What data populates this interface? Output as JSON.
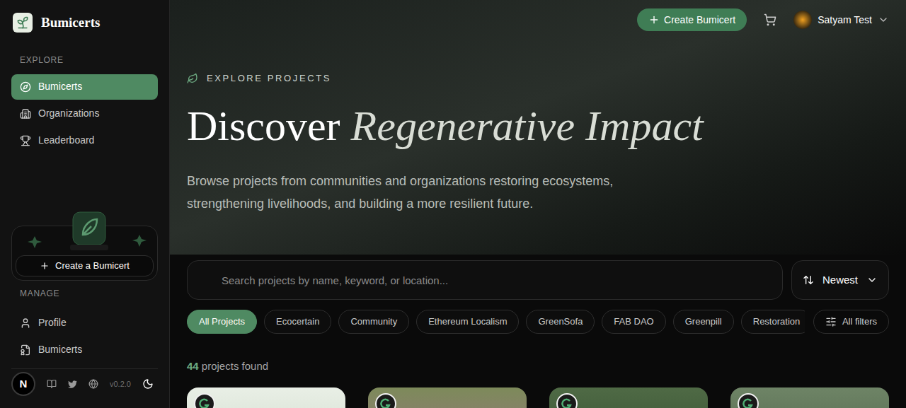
{
  "app": {
    "name": "Bumicerts"
  },
  "sidebar": {
    "sections": [
      {
        "label": "EXPLORE",
        "items": [
          {
            "label": "Bumicerts",
            "icon": "compass",
            "selected": true
          },
          {
            "label": "Organizations",
            "icon": "building",
            "selected": false
          },
          {
            "label": "Leaderboard",
            "icon": "trophy",
            "selected": false
          }
        ]
      },
      {
        "label": "MANAGE",
        "items": [
          {
            "label": "Profile",
            "icon": "user",
            "selected": false
          },
          {
            "label": "Bumicerts",
            "icon": "badge",
            "selected": false
          }
        ]
      }
    ],
    "promo": {
      "button": "Create a Bumicert"
    },
    "footer": {
      "avatar_letter": "N",
      "version": "v0.2.0"
    }
  },
  "header": {
    "create_button": "Create Bumicert",
    "user": {
      "name": "Satyam Test"
    }
  },
  "hero": {
    "eyebrow": "EXPLORE PROJECTS",
    "title": "Discover",
    "title_emphasis": "Regenerative Impact",
    "description": "Browse projects from communities and organizations restoring ecosystems, strengthening livelihoods, and building a more resilient future."
  },
  "search": {
    "placeholder": "Search projects by name, keyword, or location..."
  },
  "sort": {
    "value": "Newest"
  },
  "chips": [
    {
      "label": "All Projects",
      "selected": true
    },
    {
      "label": "Ecocertain",
      "selected": false
    },
    {
      "label": "Community",
      "selected": false
    },
    {
      "label": "Ethereum Localism",
      "selected": false
    },
    {
      "label": "GreenSofa",
      "selected": false
    },
    {
      "label": "FAB DAO",
      "selected": false
    },
    {
      "label": "Greenpill",
      "selected": false
    },
    {
      "label": "Restoration",
      "selected": false
    }
  ],
  "filters_button": "All filters",
  "results": {
    "count": "44",
    "label": "projects found"
  }
}
